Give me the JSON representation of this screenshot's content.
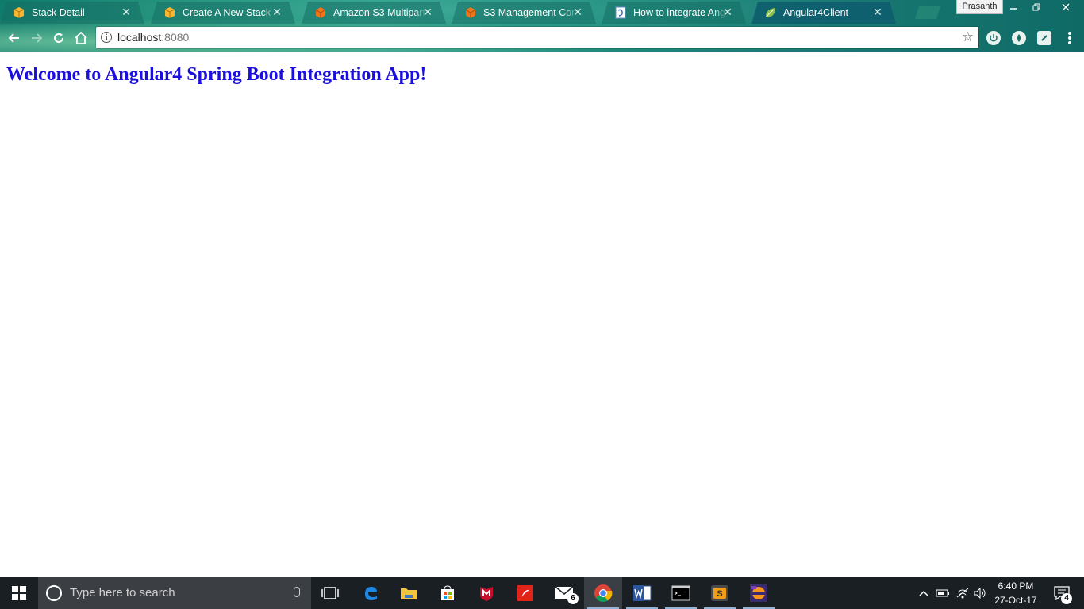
{
  "browser": {
    "tabs": [
      {
        "title": "Stack Detail",
        "icon": "aws-box-icon"
      },
      {
        "title": "Create A New Stack",
        "icon": "aws-box-icon"
      },
      {
        "title": "Amazon S3 Multipart Up",
        "icon": "aws-cube-icon"
      },
      {
        "title": "S3 Management Consol",
        "icon": "aws-cube-icon"
      },
      {
        "title": "How to integrate Angul",
        "icon": "document-icon"
      },
      {
        "title": "Angular4Client",
        "icon": "spring-leaf-icon"
      }
    ],
    "active_tab_index": 5,
    "profile_name": "Prasanth",
    "address_host": "localhost",
    "address_port": ":8080"
  },
  "page": {
    "heading": "Welcome to Angular4 Spring Boot Integration App!",
    "heading_color": "#1a0fdc"
  },
  "taskbar": {
    "search_placeholder": "Type here to search",
    "mail_badge": "6",
    "time": "6:40 PM",
    "date": "27-Oct-17",
    "notifications_count": "4"
  }
}
